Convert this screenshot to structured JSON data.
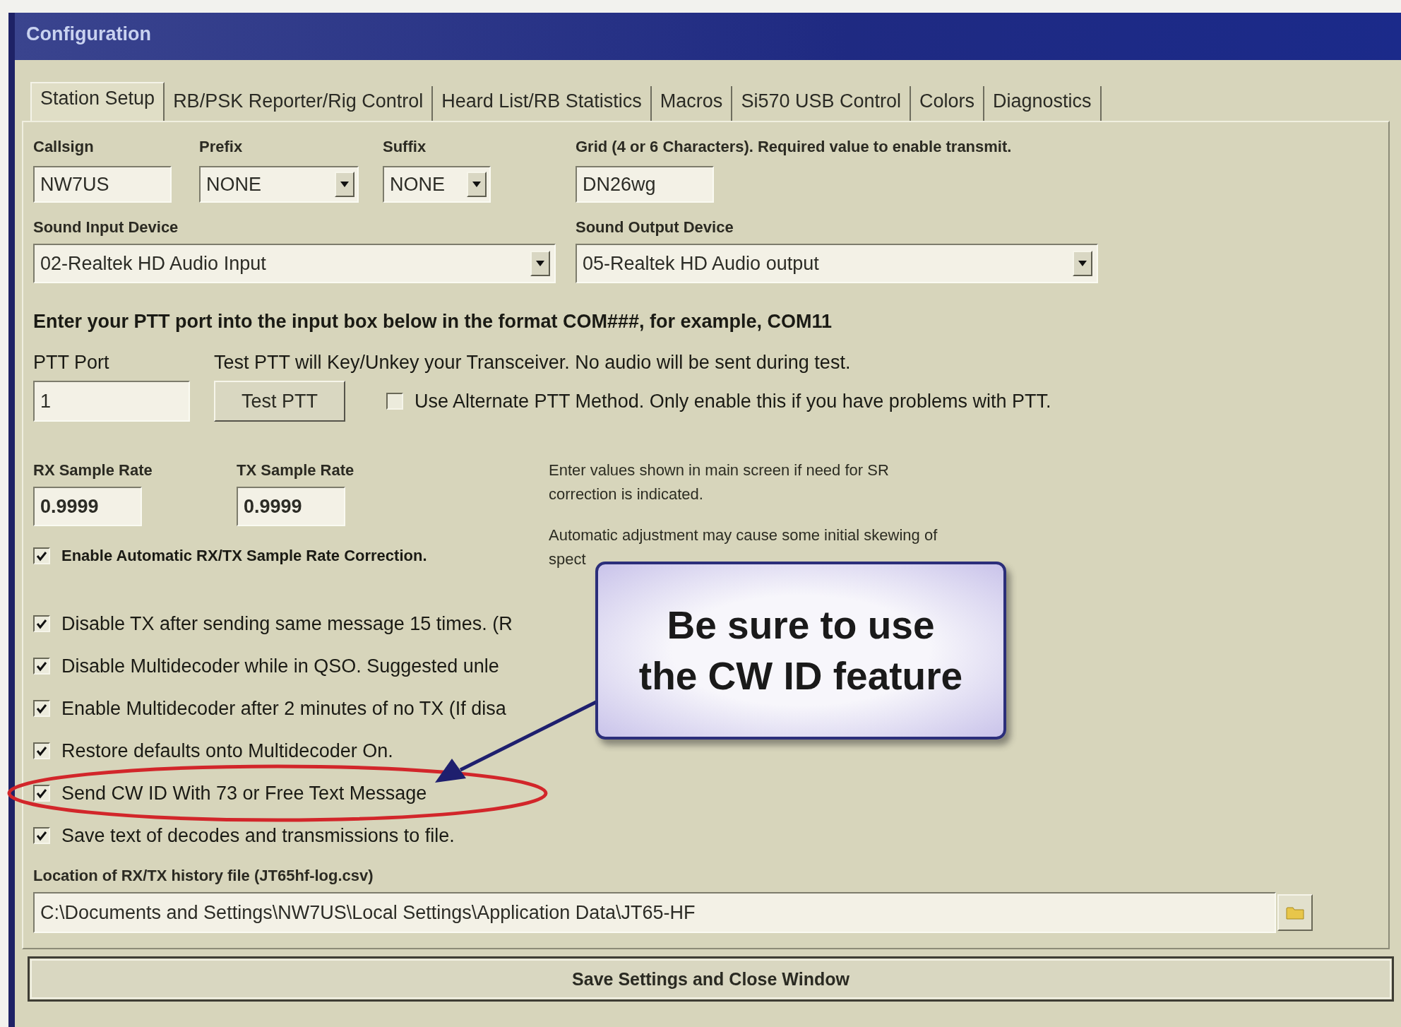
{
  "window": {
    "title": "Configuration"
  },
  "tabs": [
    {
      "label": "Station Setup",
      "selected": true
    },
    {
      "label": "RB/PSK Reporter/Rig Control",
      "selected": false
    },
    {
      "label": "Heard List/RB Statistics",
      "selected": false
    },
    {
      "label": "Macros",
      "selected": false
    },
    {
      "label": "Si570 USB Control",
      "selected": false
    },
    {
      "label": "Colors",
      "selected": false
    },
    {
      "label": "Diagnostics",
      "selected": false
    }
  ],
  "station": [
    {
      "label": "Callsign",
      "value": "NW7US",
      "kind": "text"
    },
    {
      "label": "Prefix",
      "value": "NONE",
      "kind": "combo"
    },
    {
      "label": "Suffix",
      "value": "NONE",
      "kind": "combo"
    },
    {
      "label": "Grid (4 or 6 Characters).  Required value to enable transmit.",
      "value": "DN26wg",
      "kind": "text"
    }
  ],
  "sound": [
    {
      "label": "Sound Input Device",
      "value": "02-Realtek HD Audio Input"
    },
    {
      "label": "Sound Output Device",
      "value": "05-Realtek HD Audio output"
    }
  ],
  "ptt": {
    "instruction": "Enter your PTT port into the input box below in the format COM###, for example, COM11",
    "port_label": "PTT Port",
    "test_note": "Test PTT will Key/Unkey your Transceiver.  No audio will be sent during test.",
    "port_value": "1",
    "test_button": "Test PTT",
    "alternate": {
      "label": "Use Alternate PTT Method.  Only enable this if you have problems with PTT.",
      "checked": false
    }
  },
  "sample_rates": [
    {
      "label": "RX Sample Rate",
      "value": "0.9999"
    },
    {
      "label": "TX Sample Rate",
      "value": "0.9999"
    }
  ],
  "sr_notes": [
    [
      "Enter values shown in main screen if need for SR",
      "correction is indicated."
    ],
    [
      "Automatic adjustment may cause some initial skewing of",
      "spect"
    ]
  ],
  "auto_correction": {
    "label": "Enable Automatic RX/TX Sample Rate Correction.",
    "checked": true
  },
  "options": [
    {
      "label": "Disable TX after sending same message 15 times.  (R",
      "checked": true
    },
    {
      "label": "Disable Multidecoder while in QSO.  Suggested unle",
      "checked": true
    },
    {
      "label": "Enable Multidecoder after 2 minutes of no TX (If disa",
      "checked": true
    },
    {
      "label": "Restore defaults onto Multidecoder On.",
      "checked": true
    },
    {
      "label": "Send CW ID With 73 or Free Text Message",
      "checked": true
    },
    {
      "label": "Save text of decodes and transmissions to file.",
      "checked": true
    }
  ],
  "history": {
    "label": "Location of RX/TX history file (JT65hf-log.csv)",
    "value": "C:\\Documents and Settings\\NW7US\\Local Settings\\Application Data\\JT65-HF"
  },
  "save_button": "Save Settings and Close Window",
  "callout": {
    "lines": [
      "Be sure to use",
      "the CW ID feature"
    ]
  }
}
